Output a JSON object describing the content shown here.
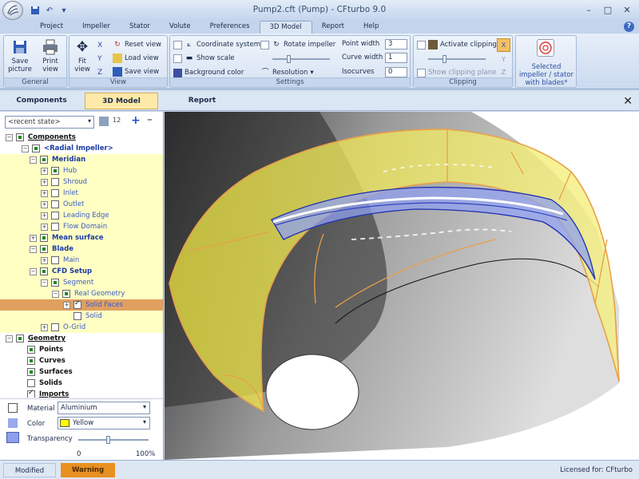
{
  "window": {
    "title": "Pump2.cft (Pump) - CFturbo 9.0"
  },
  "menu_tabs": [
    "Project",
    "Impeller",
    "Stator",
    "Volute",
    "Preferences",
    "3D Model",
    "Report",
    "Help"
  ],
  "ribbon": {
    "general": {
      "label": "General",
      "save": "Save picture",
      "print": "Print view"
    },
    "view": {
      "label": "View",
      "fit": "Fit view",
      "reset": "Reset view",
      "load": "Load view",
      "save": "Save view"
    },
    "settings": {
      "label": "Settings",
      "coord": "Coordinate system",
      "scale": "Show scale",
      "bg": "Background color",
      "rotate": "Rotate impeller",
      "resolution": "Resolution",
      "point_width_label": "Point width",
      "point_width": "3",
      "curve_width_label": "Curve width",
      "curve_width": "1",
      "isocurves_label": "Isocurves",
      "isocurves": "0"
    },
    "clipping": {
      "label": "Clipping",
      "activate": "Activate clipping",
      "show_plane": "Show clipping plane"
    },
    "selected": {
      "text": "Selected impeller / stator with blades*"
    }
  },
  "subtabs": {
    "components": "Components",
    "model3d": "3D Model",
    "report": "Report"
  },
  "state_combo": "<recent state>",
  "tree": [
    {
      "label": "Components",
      "style": "k"
    },
    {
      "label": "<Radial Impeller>",
      "style": "b"
    },
    {
      "label": "Meridian",
      "style": "b"
    },
    {
      "label": "Hub",
      "style": "n"
    },
    {
      "label": "Shroud",
      "style": "n"
    },
    {
      "label": "Inlet",
      "style": "n"
    },
    {
      "label": "Outlet",
      "style": "n"
    },
    {
      "label": "Leading Edge",
      "style": "n"
    },
    {
      "label": "Flow Domain",
      "style": "n"
    },
    {
      "label": "Mean surface",
      "style": "b"
    },
    {
      "label": "Blade",
      "style": "b"
    },
    {
      "label": "Main",
      "style": "n"
    },
    {
      "label": "CFD Setup",
      "style": "b"
    },
    {
      "label": "Segment",
      "style": "n"
    },
    {
      "label": "Real Geometry",
      "style": "n"
    },
    {
      "label": "Solid Faces",
      "style": "n"
    },
    {
      "label": "Solid",
      "style": "n"
    },
    {
      "label": "O-Grid",
      "style": "n"
    },
    {
      "label": "Geometry",
      "style": "k"
    },
    {
      "label": "Points",
      "style": "k"
    },
    {
      "label": "Curves",
      "style": "k"
    },
    {
      "label": "Surfaces",
      "style": "k"
    },
    {
      "label": "Solids",
      "style": "k"
    },
    {
      "label": "Imports",
      "style": "k"
    }
  ],
  "props": {
    "material_label": "Material",
    "material": "Aluminium",
    "color_label": "Color",
    "color": "Yellow",
    "color_hex": "#ffff00",
    "transparency_label": "Transparency",
    "min": "0",
    "max": "100%",
    "transparency_value": 0.42
  },
  "status": {
    "modified": "Modified",
    "warning": "Warning",
    "license": "Licensed for: CFturbo"
  }
}
